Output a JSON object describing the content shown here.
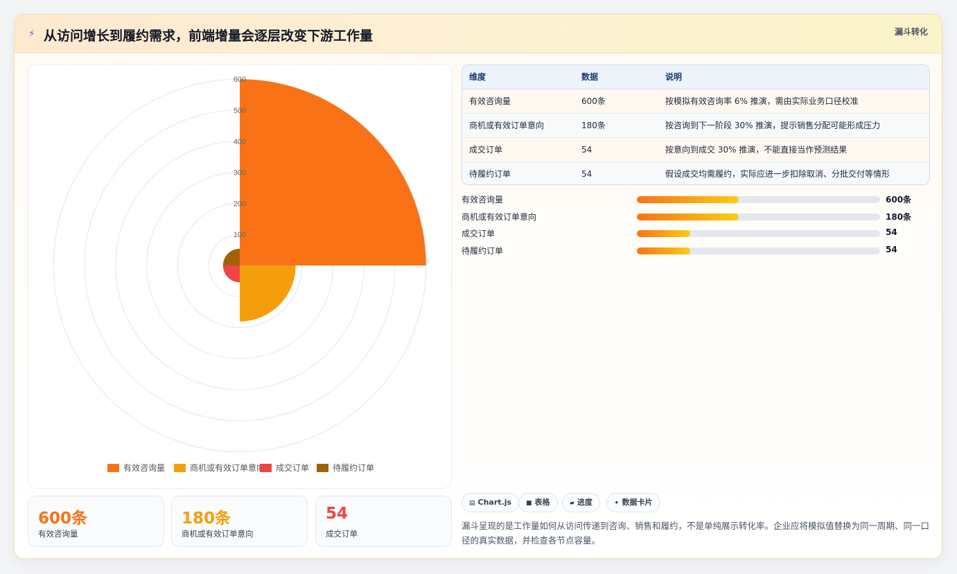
{
  "header": {
    "icon": "bolt-icon",
    "title": "从访问增长到履约需求，前端增量会逐层改变下游工作量",
    "tag": "漏斗转化"
  },
  "chart_data": {
    "type": "polarArea",
    "categories": [
      "有效咨询量",
      "商机或有效订单意向",
      "成交订单",
      "待履约订单"
    ],
    "values": [
      600,
      180,
      54,
      54
    ],
    "colors": [
      "#f97316",
      "#f59e0b",
      "#ef4444",
      "#a16207"
    ],
    "r_ticks": [
      "100",
      "200",
      "300",
      "400",
      "500",
      "600"
    ],
    "r_range": [
      0,
      600
    ],
    "legend_position": "bottom"
  },
  "table": {
    "headers": [
      "维度",
      "数据",
      "说明"
    ],
    "rows": [
      [
        "有效咨询量",
        "600条",
        "按模拟有效咨询率 6% 推演，需由实际业务口径校准"
      ],
      [
        "商机或有效订单意向",
        "180条",
        "按咨询到下一阶段 30% 推演，提示销售分配可能形成压力"
      ],
      [
        "成交订单",
        "54",
        "按意向到成交 30% 推演，不能直接当作预测结果"
      ],
      [
        "待履约订单",
        "54",
        "假设成交均需履约，实际应进一步扣除取消、分批交付等情形"
      ]
    ]
  },
  "progress": [
    {
      "label": "有效咨询量",
      "value": "600条",
      "fill": 0.42
    },
    {
      "label": "商机或有效订单意向",
      "value": "180条",
      "fill": 0.42
    },
    {
      "label": "成交订单",
      "value": "54",
      "fill": 0.22
    },
    {
      "label": "待履约订单",
      "value": "54",
      "fill": 0.22
    }
  ],
  "chips": [
    {
      "icon": "▤",
      "label": "Chart.js"
    },
    {
      "icon": "■",
      "label": "表格"
    },
    {
      "icon": "▰",
      "label": "进度"
    },
    {
      "icon": "✦",
      "label": "数据卡片"
    }
  ],
  "description": "漏斗呈现的是工作量如何从访问传递到咨询、销售和履约，不是单纯展示转化率。企业应将模拟值替换为同一周期、同一口径的真实数据，并检查各节点容量。",
  "stats": [
    {
      "value": "600条",
      "label": "有效咨询量",
      "color": "#f97316"
    },
    {
      "value": "180条",
      "label": "商机或有效订单意向",
      "color": "#f59e0b"
    },
    {
      "value": "54",
      "label": "成交订单",
      "color": "#ef4444"
    }
  ]
}
